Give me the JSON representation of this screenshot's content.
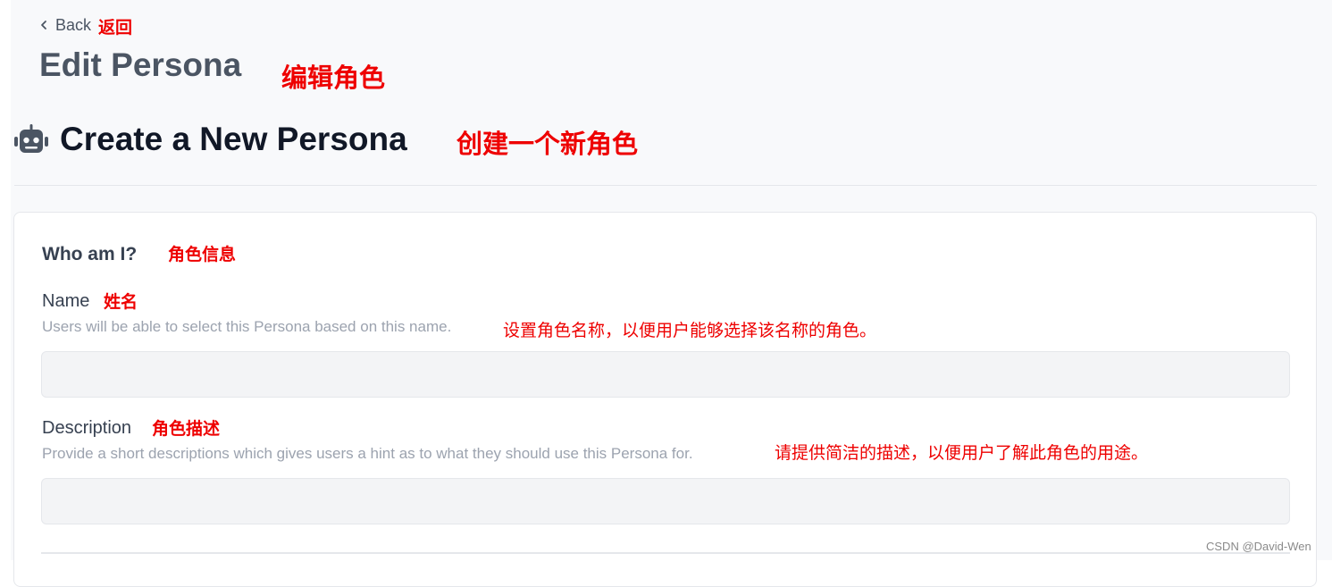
{
  "header": {
    "back_label": "Back",
    "back_note": "返回",
    "edit_title": "Edit Persona",
    "edit_note": "编辑角色",
    "create_title": "Create a New Persona",
    "create_note": "创建一个新角色",
    "create_icon": "robot-icon"
  },
  "form": {
    "section_title": "Who am I?",
    "section_note": "角色信息",
    "name": {
      "label": "Name",
      "label_note": "姓名",
      "help": "Users will be able to select this Persona based on this name.",
      "help_note": "设置角色名称，以便用户能够选择该名称的角色。",
      "value": ""
    },
    "description": {
      "label": "Description",
      "label_note": "角色描述",
      "help": "Provide a short descriptions which gives users a hint as to what they should use this Persona for.",
      "help_note": "请提供简洁的描述，以便用户了解此角色的用途。",
      "value": ""
    }
  },
  "watermark": "CSDN @David-Wen",
  "colors": {
    "annotation": "#ee0000",
    "page_background": "#f8f9fb",
    "input_background": "#f3f4f6"
  }
}
